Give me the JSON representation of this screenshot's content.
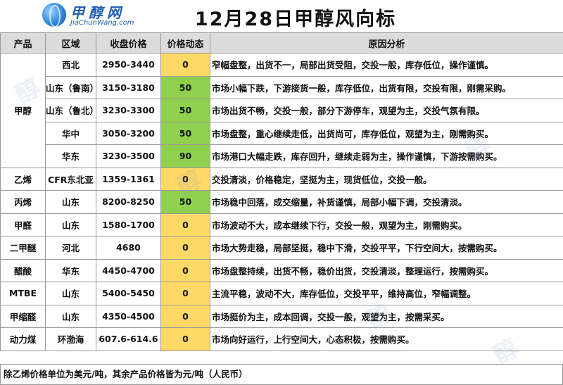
{
  "logo": {
    "cn": "甲醇网",
    "en": "JiaChunWang.com"
  },
  "title": "12月28日甲醇风向标",
  "columns": [
    "产品",
    "区域",
    "收盘价格",
    "价格动态",
    "原因分析"
  ],
  "groups": [
    {
      "product": "甲醇",
      "rows": [
        {
          "region": "西北",
          "price": "2950-3440",
          "dynamic": "0",
          "reason": "窄幅盘整，出货不一，局部出货受阻，交投一般，库存低位，操作谨慎。"
        },
        {
          "region": "山东（鲁南）",
          "price": "3150-3180",
          "dynamic": "50",
          "reason": "市场小幅下跌，下游接货一般，库存低位，出货有限，交投有限，刚需采购。"
        },
        {
          "region": "山东（鲁北）",
          "price": "3230-3300",
          "dynamic": "50",
          "reason": "市场出货不畅，交投一般，部分下游停车，观望为主，交投气氛有限。"
        },
        {
          "region": "华中",
          "price": "3050-3200",
          "dynamic": "50",
          "reason": "市场盘整，重心继续走低，出货尚可，库存低位，观望为主，刚需购买。"
        },
        {
          "region": "华东",
          "price": "3230-3500",
          "dynamic": "90",
          "reason": "市场港口大幅走跌，库存回升，继续走弱为主，操作谨慎，下游按需购买。"
        }
      ]
    },
    {
      "product": "乙烯",
      "rows": [
        {
          "region": "CFR东北亚",
          "price": "1359-1361",
          "dynamic": "0",
          "reason": "交投清淡，价格稳定，坚挺为主，现货低位，交投一般。"
        }
      ]
    },
    {
      "product": "丙烯",
      "rows": [
        {
          "region": "山东",
          "price": "8200-8250",
          "dynamic": "50",
          "reason": "市场稳中回落，成交缩量，补货谨慎，局部小幅下调，交投清淡。"
        }
      ]
    },
    {
      "product": "甲醛",
      "rows": [
        {
          "region": "山东",
          "price": "1580-1700",
          "dynamic": "0",
          "reason": "市场波动不大，成本继续下行，交投一般，观望为主，刚需购买。"
        }
      ]
    },
    {
      "product": "二甲醚",
      "rows": [
        {
          "region": "河北",
          "price": "4680",
          "dynamic": "0",
          "reason": "市场大势走稳，局部坚挺，稳中下滑，交投平平，下行空间大，按需购买。"
        }
      ]
    },
    {
      "product": "醋酸",
      "rows": [
        {
          "region": "华东",
          "price": "4450-4700",
          "dynamic": "0",
          "reason": "市场盘整持续，出货不畅，稳价出货，交投清淡，整理运行，按需购买。"
        }
      ]
    },
    {
      "product": "MTBE",
      "rows": [
        {
          "region": "山东",
          "price": "5400-5450",
          "dynamic": "0",
          "reason": "主流平稳，波动不大，库存低位，交投平平，维持高位，窄幅调整。"
        }
      ]
    },
    {
      "product": "甲缩醛",
      "rows": [
        {
          "region": "山东",
          "price": "4350-4500",
          "dynamic": "0",
          "reason": "市场挺价为主，成本回调，交投一般，观望为主，按需采买。"
        }
      ]
    },
    {
      "product": "动力煤",
      "rows": [
        {
          "region": "环渤海",
          "price": "607.6-614.6",
          "dynamic": "0",
          "reason": "市场向好运行，上行空间大，心态积极，按需购买。"
        }
      ]
    }
  ],
  "footer": "除乙烯价格单位为美元/吨，其余产品价格皆为元/吨（人民币）",
  "colors": {
    "dynamic_zero": "#ffd966",
    "dynamic_up": "#8fd14f",
    "header_bg": "#dcdcdc"
  }
}
